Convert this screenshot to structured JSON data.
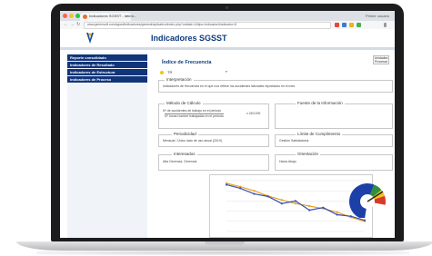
{
  "browser": {
    "tab_title": "Indicadores SGSST - Intern...",
    "tab_close": "×",
    "user_chip": "Primer usuario",
    "nav": [
      "←",
      "→",
      "↻"
    ],
    "url": "www.gerensoft.com/sgsst/indicadores/general/aplicativo/index.php?unidad=1&tipo=indicador&indicador=5"
  },
  "app": {
    "title": "Indicadores SGSST"
  },
  "sidebar": {
    "items": [
      {
        "label": "Reporte consolidado"
      },
      {
        "label": "Indicadores de Resultado"
      },
      {
        "label": "Indicadores de Estructura"
      },
      {
        "label": "Indicadores de Proceso"
      }
    ]
  },
  "main": {
    "title": "Índice de Frecuencia",
    "top_right": "Unidades Procesar",
    "selector_value": "TR",
    "sections": {
      "interpretacion": {
        "legend": "Interpretación",
        "text": "Indicadores de frecuencia en el que nos refiere los accidentes laborales reportados en el mes"
      },
      "metodo": {
        "legend": "Método de Cálculo",
        "line1": "Nº de accidentes de trabajo en el periodo",
        "line2": "Nº horas hombre trabajadas en el periodo",
        "factor": "x 240.000"
      },
      "fuente": {
        "legend": "Fuente de la Información",
        "text": ""
      },
      "periodicidad": {
        "legend": "Periodicidad",
        "text": "Mensual / Único dato de uso anual (2019)"
      },
      "limite": {
        "legend": "Límite de Cumplimiento",
        "text": "Gestión Satisfactoria"
      },
      "interesados": {
        "legend": "Interesados",
        "text": "Alta Gerencia, Gerencia"
      },
      "orientacion": {
        "legend": "Orientación",
        "text": "Hacia Abajo"
      }
    }
  },
  "chart_data": {
    "type": "line",
    "x": [
      1,
      2,
      3,
      4,
      5,
      6,
      7,
      8,
      9,
      10,
      11
    ],
    "series": [
      {
        "values": [
          0.95,
          0.88,
          0.8,
          0.7,
          0.62,
          0.55,
          0.5,
          0.45,
          0.38,
          0.28,
          0.2
        ]
      },
      {
        "values": [
          0.92,
          0.85,
          0.74,
          0.69,
          0.55,
          0.6,
          0.42,
          0.47,
          0.33,
          0.3,
          0.22
        ]
      }
    ],
    "ylim": [
      0,
      1
    ],
    "colors": [
      "#e8a21a",
      "#3a4fb5"
    ]
  },
  "gauge": {
    "colors": [
      "#1d3fa8",
      "#2f8f3a",
      "#f0c419",
      "#d83a2a"
    ]
  }
}
